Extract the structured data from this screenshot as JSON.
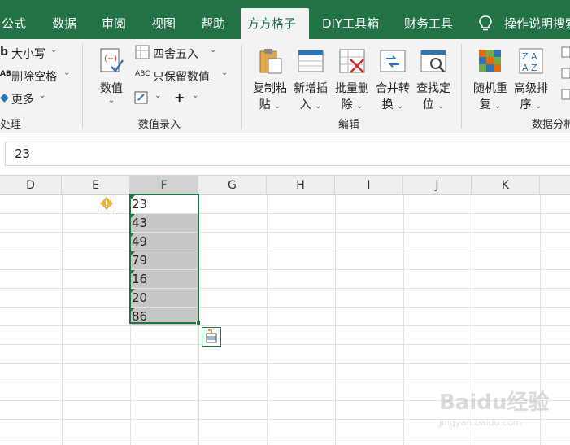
{
  "tabs": {
    "t1": "公式",
    "t2": "数据",
    "t3": "审阅",
    "t4": "视图",
    "t5": "帮助",
    "t6": "方方格子",
    "t7": "DIY工具箱",
    "t8": "财务工具",
    "search": "操作说明搜索"
  },
  "ribbon": {
    "text_group": {
      "case": "大小写",
      "del_space": "删除空格",
      "more": "更多",
      "label": "处理"
    },
    "number_group": {
      "value_btn": "数值",
      "round": "四舍五入",
      "keep_value": "只保留数值",
      "label": "数值录入"
    },
    "edit_group": {
      "copy_paste_1": "复制粘",
      "copy_paste_2": "贴",
      "insert_1": "新增插",
      "insert_2": "入",
      "batch_del_1": "批量删",
      "batch_del_2": "除",
      "merge_1": "合并转",
      "merge_2": "换",
      "find_1": "查找定",
      "find_2": "位",
      "label": "编辑"
    },
    "analysis_group": {
      "random_1": "随机重",
      "random_2": "复",
      "sort_1": "高级排",
      "sort_2": "序",
      "label": "数据分析"
    }
  },
  "formula_bar": {
    "value": "23"
  },
  "columns": [
    "D",
    "E",
    "F",
    "G",
    "H",
    "I",
    "J",
    "K"
  ],
  "selected_column": "F",
  "cells": [
    "23",
    "43",
    "49",
    "79",
    "16",
    "20",
    "86"
  ],
  "watermark": {
    "brand": "Baidu经验",
    "url": "jingyan.baidu.com"
  },
  "colors": {
    "accent": "#217346",
    "selection_fill": "#c6c6c6",
    "warning": "#f0b43c"
  }
}
